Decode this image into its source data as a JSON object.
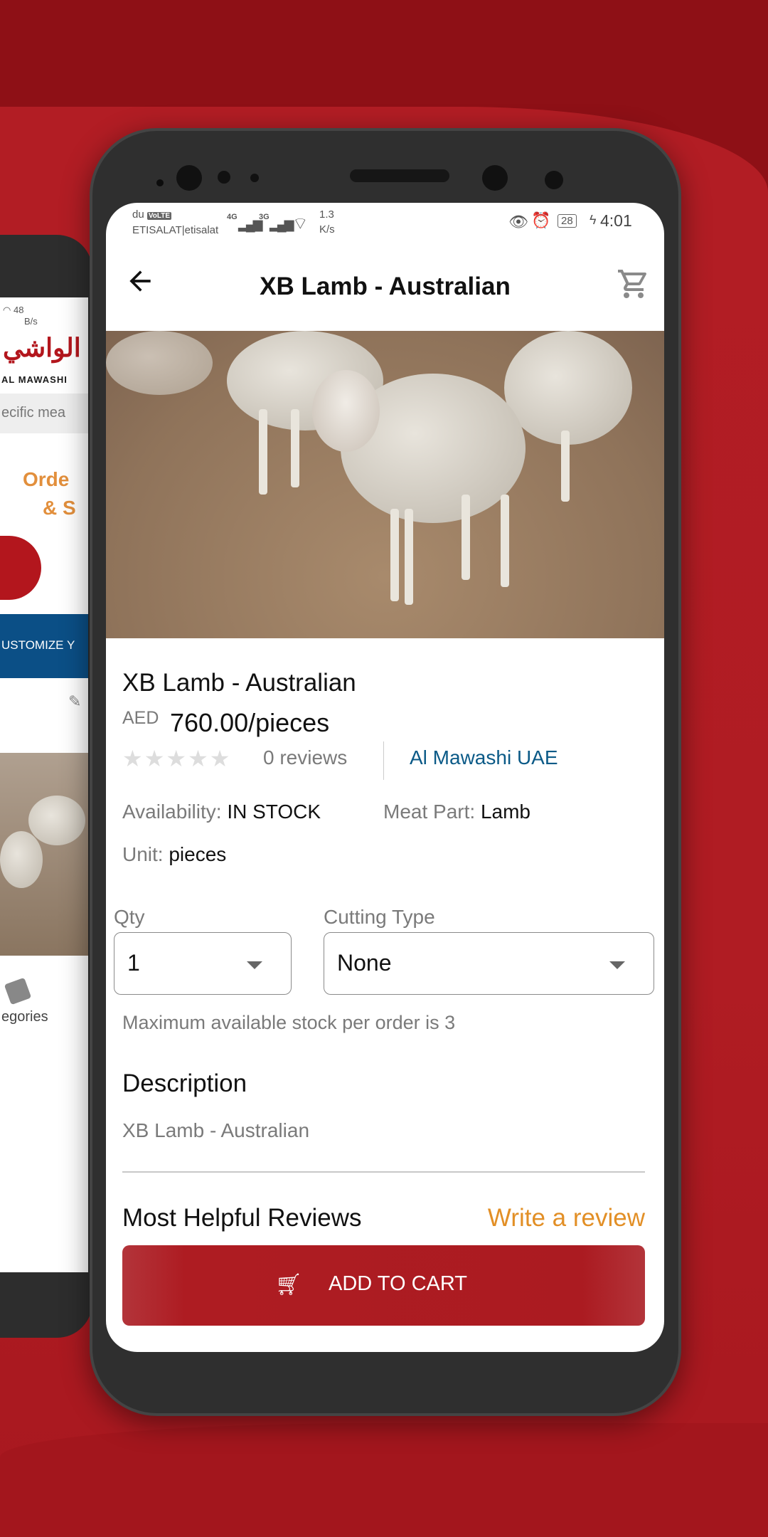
{
  "colors": {
    "brand_red": "#ae1c22",
    "link_blue": "#0b5a87",
    "accent_orange": "#e28f26"
  },
  "back_phone": {
    "status_speed": "48",
    "status_unit": "B/s",
    "logo_text": "AL MAWASHI",
    "search_placeholder": "ecific mea",
    "promo_line1": "Orde",
    "promo_line2": "& S",
    "customize": "USTOMIZE Y",
    "nav_label": "egories"
  },
  "status_bar": {
    "carrier1": "du",
    "volte": "VoLTE",
    "carrier2": "ETISALAT|etisalat",
    "net1": "4G",
    "net2": "3G",
    "speed": "1.3",
    "speed_unit": "K/s",
    "battery": "28",
    "time": "4:01"
  },
  "header": {
    "title": "XB Lamb - Australian",
    "back_icon": "arrow-left-icon",
    "cart_icon": "cart-icon"
  },
  "product": {
    "name": "XB Lamb - Australian",
    "currency": "AED",
    "price": "760.00/pieces",
    "rating": 0,
    "reviews": "0 reviews",
    "seller": "Al Mawashi UAE",
    "availability_label": "Availability:",
    "availability": "IN STOCK",
    "meat_part_label": "Meat Part:",
    "meat_part": "Lamb",
    "unit_label": "Unit:",
    "unit": "pieces"
  },
  "options": {
    "qty_label": "Qty",
    "qty_value": "1",
    "cutting_label": "Cutting Type",
    "cutting_value": "None",
    "stock_note": "Maximum available stock per order is 3"
  },
  "description": {
    "heading": "Description",
    "text": "XB Lamb - Australian"
  },
  "reviews": {
    "heading": "Most Helpful Reviews",
    "write": "Write a review"
  },
  "cart_button": {
    "label": "ADD TO CART"
  }
}
